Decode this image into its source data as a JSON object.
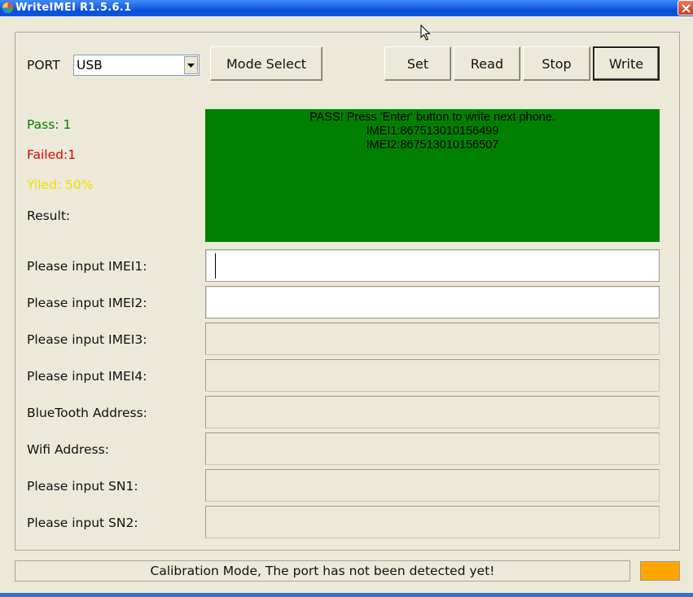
{
  "window": {
    "title": "WriteIMEI R1.5.6.1"
  },
  "port": {
    "label": "PORT",
    "selected": "USB"
  },
  "toolbar": {
    "mode_select": "Mode Select",
    "set": "Set",
    "read": "Read",
    "stop": "Stop",
    "write": "Write"
  },
  "stats": {
    "pass": "Pass:  1",
    "failed": "Failed:1",
    "yield": "Yiled:  50%",
    "result": "Result:"
  },
  "result_panel": {
    "line1": "PASS! Press 'Enter'  button to write next phone.",
    "line2": "IMEI1:867513010156499",
    "line3": "IMEI2:867513010156507"
  },
  "fields": [
    {
      "label": "Please input IMEI1:",
      "value": ""
    },
    {
      "label": "Please input IMEI2:",
      "value": ""
    },
    {
      "label": "Please input IMEI3:",
      "value": ""
    },
    {
      "label": "Please input IMEI4:",
      "value": ""
    },
    {
      "label": "BlueTooth Address:",
      "value": ""
    },
    {
      "label": "Wifi Address:",
      "value": ""
    },
    {
      "label": "Please input SN1:",
      "value": ""
    },
    {
      "label": "Please input SN2:",
      "value": ""
    }
  ],
  "status": {
    "message": "Calibration Mode, The port has not been detected yet!"
  },
  "colors": {
    "pass": "#008000",
    "failed": "#e00000",
    "yield": "#f0e000",
    "result_panel": "#008000",
    "status_indicator": "#ffa500"
  },
  "icons": {
    "app": "app-icon",
    "close": "close-icon",
    "dropdown": "chevron-down-icon",
    "cursor": "mouse-cursor-icon"
  }
}
